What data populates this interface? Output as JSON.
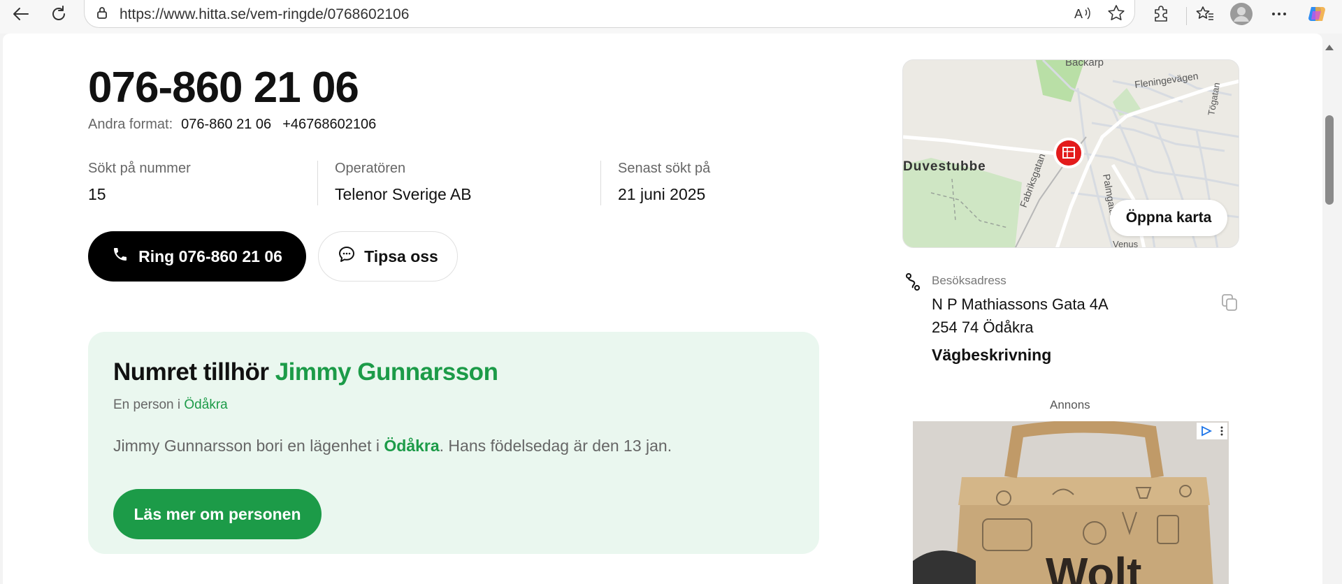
{
  "browser": {
    "url": "https://www.hitta.se/vem-ringde/0768602106"
  },
  "page": {
    "phone_title": "076-860 21 06",
    "formats": {
      "label": "Andra format:",
      "format1": "076-860 21 06",
      "format2": "+46768602106"
    },
    "stats": [
      {
        "label": "Sökt på nummer",
        "value": "15"
      },
      {
        "label": "Operatören",
        "value": "Telenor Sverige AB"
      },
      {
        "label": "Senast sökt på",
        "value": "21 juni 2025"
      }
    ],
    "call_button": "Ring 076-860 21 06",
    "tip_button": "Tipsa oss",
    "owner": {
      "title_prefix": "Numret tillhör",
      "name": "Jimmy Gunnarsson",
      "sub_prefix": "En person i",
      "sub_city": "Ödåkra",
      "desc_part1": "Jimmy Gunnarsson bori en lägenhet i",
      "desc_city": "Ödåkra",
      "desc_part2": ". Hans födelsedag är den 13 jan.",
      "more_button": "Läs mer om personen"
    }
  },
  "sidebar": {
    "map": {
      "open_button": "Öppna karta",
      "labels": {
        "backarp": "Backarp",
        "fleningevagen": "Fleningevägen",
        "togatan": "Tögatan",
        "duvestubbe": "Duvestubbe",
        "fabriksgatan": "Fabriksgatan",
        "palmgatan": "Palmgatan",
        "venus": "Venus"
      }
    },
    "address": {
      "label": "Besöksadress",
      "line1": "N P Mathiassons Gata 4A",
      "line2": "254 74 Ödåkra",
      "directions": "Vägbeskrivning"
    },
    "ad": {
      "label": "Annons",
      "brand": "Wolt"
    }
  },
  "colors": {
    "accent_green": "#1c9b48",
    "card_bg": "#eaf7ef",
    "map_pin": "#e31b1b"
  }
}
